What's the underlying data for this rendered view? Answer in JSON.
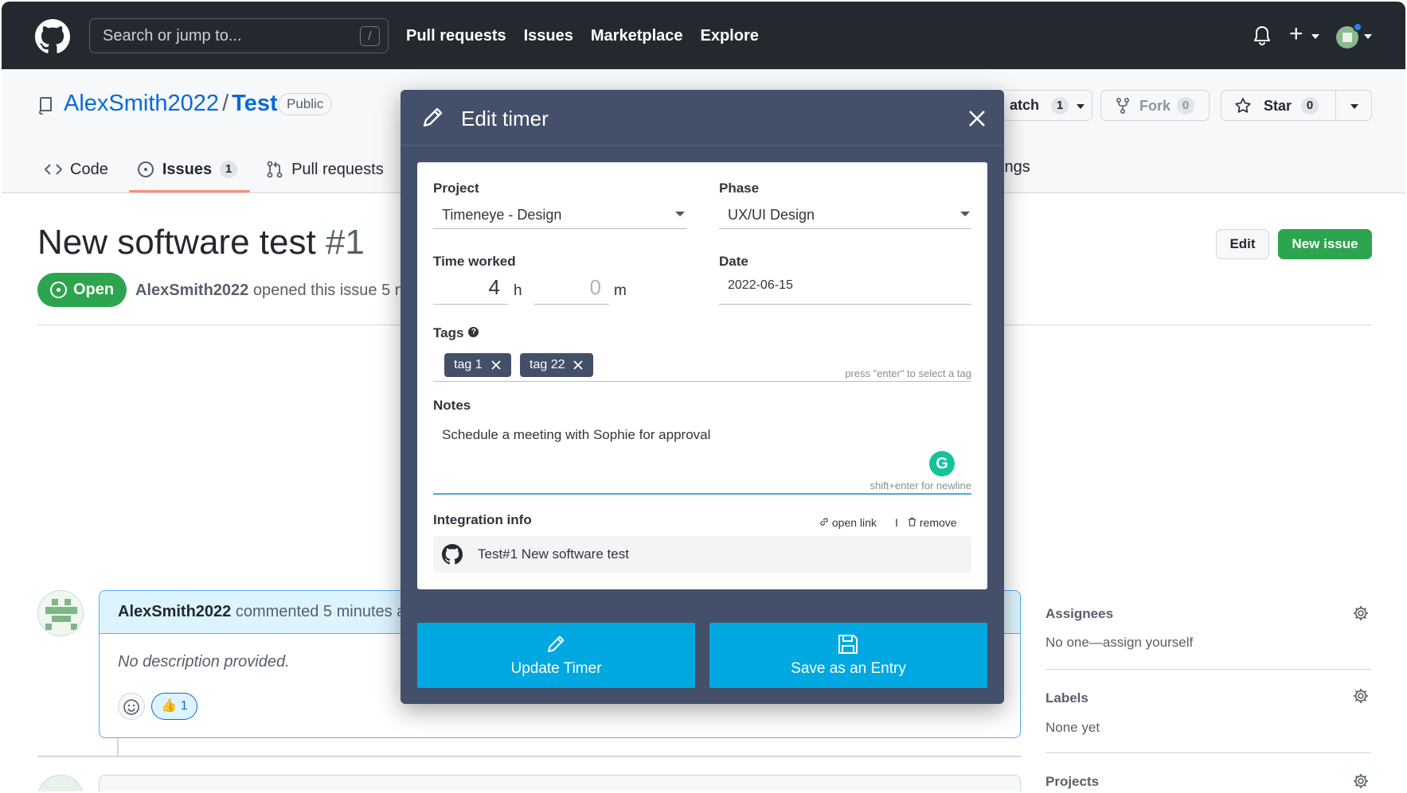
{
  "header": {
    "search_placeholder": "Search or jump to...",
    "search_shortcut": "/",
    "nav": [
      "Pull requests",
      "Issues",
      "Marketplace",
      "Explore"
    ],
    "plus": "+"
  },
  "repo": {
    "owner": "AlexSmith2022",
    "separator": "/",
    "name": "Test",
    "visibility": "Public",
    "watch_label": "atch",
    "watch_count": "1",
    "fork_label": "Fork",
    "fork_count": "0",
    "star_label": "Star",
    "star_count": "0",
    "tabs": [
      {
        "label": "Code"
      },
      {
        "label": "Issues",
        "count": "1"
      },
      {
        "label": "Pull requests"
      }
    ],
    "settings_tab_partial": "ings"
  },
  "issue": {
    "title": "New software test",
    "number": "#1",
    "state": "Open",
    "author": "AlexSmith2022",
    "meta": "opened this issue 5 m",
    "edit_label": "Edit",
    "new_issue_label": "New issue",
    "comment_author": "AlexSmith2022",
    "comment_meta": "commented 5 minutes a",
    "comment_body": "No description provided.",
    "reaction_emoji": "👍",
    "reaction_count": "1"
  },
  "sidebar": {
    "assignees_heading": "Assignees",
    "assignees_value": "No one—assign yourself",
    "labels_heading": "Labels",
    "labels_value": "None yet",
    "projects_heading": "Projects"
  },
  "modal": {
    "title": "Edit timer",
    "project_label": "Project",
    "project_value": "Timeneye - Design",
    "phase_label": "Phase",
    "phase_value": "UX/UI Design",
    "time_label": "Time worked",
    "hours": "4",
    "hours_unit": "h",
    "minutes": "0",
    "minutes_unit": "m",
    "date_label": "Date",
    "date_value": "2022-06-15",
    "tags_label": "Tags",
    "tags_help": "?",
    "tags": [
      "tag 1",
      "tag 22"
    ],
    "tags_hint": "press \"enter\" to select a tag",
    "notes_label": "Notes",
    "notes_value": "Schedule a meeting with Sophie for approval",
    "notes_hint": "shift+enter for newline",
    "grammarly": "G",
    "integration_label": "Integration info",
    "open_link": "open link",
    "divider": "I",
    "remove": "remove",
    "integration_value": "Test#1 New software test",
    "update_button": "Update Timer",
    "save_button": "Save as an Entry"
  },
  "colors": {
    "header_bg": "#24292f",
    "modal_bg": "#445069",
    "action_blue": "#00a8e2",
    "github_green": "#2da44e",
    "link_blue": "#0969da"
  }
}
